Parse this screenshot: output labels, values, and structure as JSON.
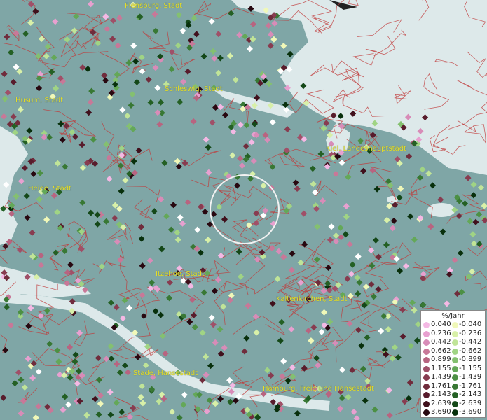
{
  "cities": [
    {
      "id": "flensburg",
      "label": "Flensburg, Stadt"
    },
    {
      "id": "schleswig",
      "label": "Schleswig, Stadt"
    },
    {
      "id": "husum",
      "label": "Husum, Stadt"
    },
    {
      "id": "kiel",
      "label": "Kiel, Landeshauptstadt"
    },
    {
      "id": "heide",
      "label": "Heide, Stadt"
    },
    {
      "id": "itzehoe",
      "label": "Itzehoe, Stadt"
    },
    {
      "id": "kaltenkirchen",
      "label": "Kaltenkirchen, Stadt"
    },
    {
      "id": "stade",
      "label": "Stade, Hansestadt"
    },
    {
      "id": "hamburg",
      "label": "Hamburg, Freie und Hansestadt"
    }
  ],
  "legend": {
    "title": "%/Jahr",
    "positive": [
      {
        "value": "0.040",
        "color": "#f4b8e4"
      },
      {
        "value": "0.236",
        "color": "#e8a0d0"
      },
      {
        "value": "0.442",
        "color": "#d88cb8"
      },
      {
        "value": "0.662",
        "color": "#c87898"
      },
      {
        "value": "0.899",
        "color": "#b86480"
      },
      {
        "value": "1.155",
        "color": "#a05068"
      },
      {
        "value": "1.439",
        "color": "#883c50"
      },
      {
        "value": "1.761",
        "color": "#702c3c"
      },
      {
        "value": "2.143",
        "color": "#581c2c"
      },
      {
        "value": "2.639",
        "color": "#40101c"
      },
      {
        "value": "3.690",
        "color": "#280810"
      }
    ],
    "negative": [
      {
        "value": "-0.040",
        "color": "#f0f8b8"
      },
      {
        "value": "-0.236",
        "color": "#d8f0a8"
      },
      {
        "value": "-0.442",
        "color": "#c0e498"
      },
      {
        "value": "-0.662",
        "color": "#a0d484"
      },
      {
        "value": "-0.899",
        "color": "#84c070"
      },
      {
        "value": "-1.155",
        "color": "#64a858"
      },
      {
        "value": "-1.439",
        "color": "#4c9044"
      },
      {
        "value": "-1.761",
        "color": "#387834"
      },
      {
        "value": "-2.143",
        "color": "#246024"
      },
      {
        "value": "-2.639",
        "color": "#144818"
      },
      {
        "value": "-3.690",
        "color": "#08300c"
      }
    ]
  },
  "colors": {
    "water": "#e0ecec",
    "land": "#7fa6a6",
    "boundary": "#c03a3a",
    "city_label": "#e8e02a"
  }
}
